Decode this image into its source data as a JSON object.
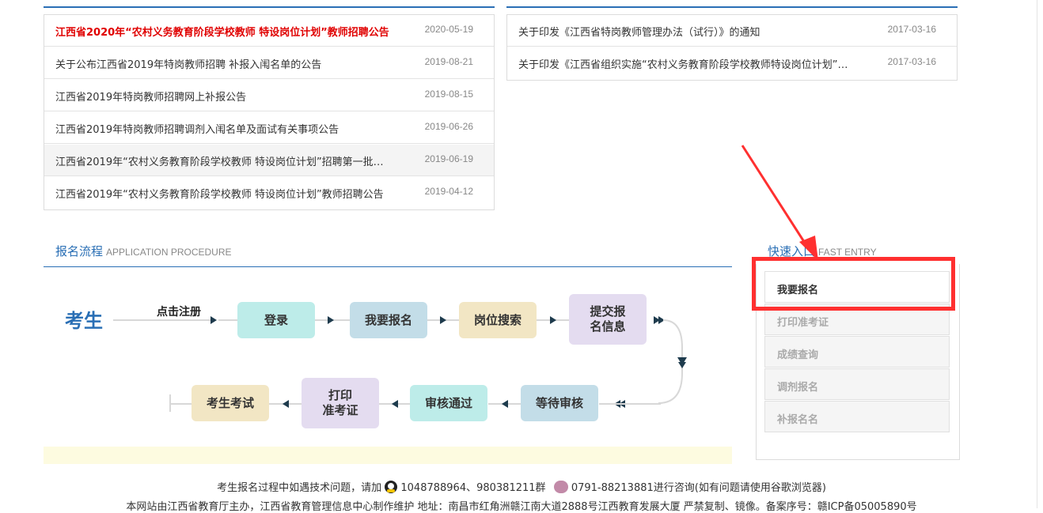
{
  "news_left": [
    {
      "title": "江西省2020年“农村义务教育阶段学校教师 特设岗位计划”教师招聘公告",
      "date": "2020-05-19"
    },
    {
      "title": "关于公布江西省2019年特岗教师招聘 补报入闱名单的公告",
      "date": "2019-08-21"
    },
    {
      "title": "江西省2019年特岗教师招聘网上补报公告",
      "date": "2019-08-15"
    },
    {
      "title": "江西省2019年特岗教师招聘调剂入闱名单及面试有关事项公告",
      "date": "2019-06-26"
    },
    {
      "title": "江西省2019年“农村义务教育阶段学校教师 特设岗位计划”招聘第一批…",
      "date": "2019-06-19"
    },
    {
      "title": "江西省2019年“农村义务教育阶段学校教师 特设岗位计划”教师招聘公告",
      "date": "2019-04-12"
    }
  ],
  "news_right": [
    {
      "title": "关于印发《江西省特岗教师管理办法（试行）》的通知",
      "date": "2017-03-16"
    },
    {
      "title": "关于印发《江西省组织实施“农村义务教育阶段学校教师特设岗位计划”…",
      "date": "2017-03-16"
    }
  ],
  "procedure": {
    "title": "报名流程",
    "title_en": "APPLICATION PROCEDURE",
    "start": "考生",
    "start_action": "点击注册",
    "row1": [
      "登录",
      "我要报名",
      "岗位搜索",
      "提交报\n名信息"
    ],
    "row2": [
      "等待审核",
      "审核通过",
      "打印\n准考证",
      "考生考试"
    ]
  },
  "quick_entry": {
    "title": "快速入口",
    "title_en": "FAST ENTRY",
    "items": [
      "我要报名",
      "打印准考证",
      "成绩查询",
      "调剂报名",
      "补报名名"
    ]
  },
  "footer": {
    "line1_prefix": "考生报名过程中如遇技术问题，请加",
    "qq_numbers": "1048788964、980381211群",
    "phone": "0791-88213881进行咨询(如有问题请使用谷歌浏览器)",
    "line2": "本网站由江西省教育厅主办，江西省教育管理信息中心制作维护 地址：南昌市红角洲赣江南大道2888号江西教育发展大厦 严禁复制、镜像。备案序号：赣ICP备05005890号"
  },
  "colors": {
    "accent": "#2a6fb5",
    "highlight_red": "#e00000",
    "annotation": "#ff3030"
  }
}
